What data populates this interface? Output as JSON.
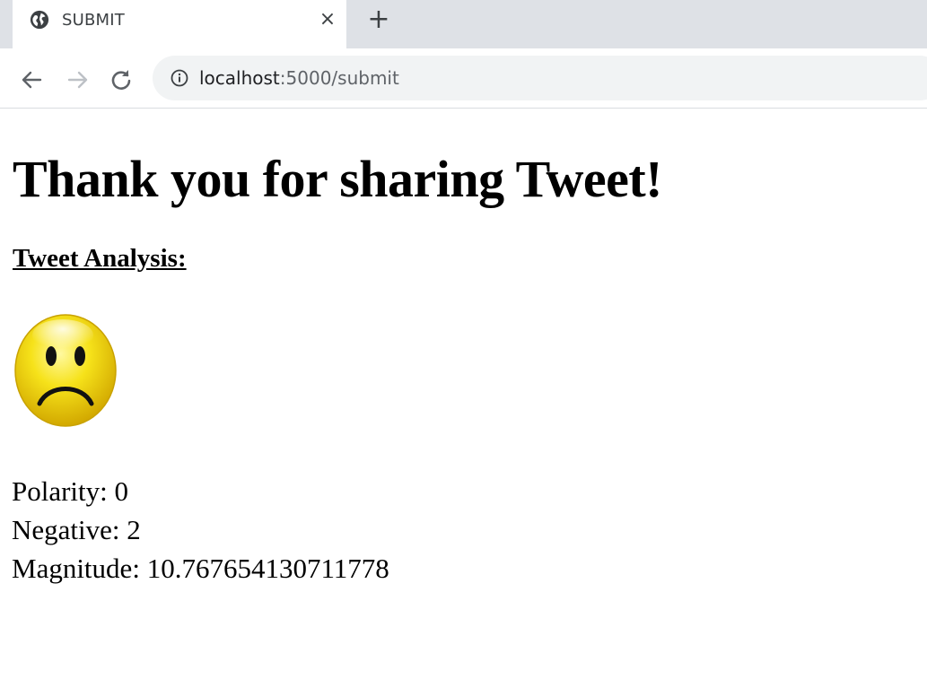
{
  "browser": {
    "tab": {
      "title": "SUBMIT",
      "favicon": "globe-icon",
      "close_icon": "close-icon"
    },
    "new_tab_icon": "plus-icon",
    "nav": {
      "back_icon": "arrow-left-icon",
      "forward_icon": "arrow-right-icon",
      "reload_icon": "reload-icon"
    },
    "address_bar": {
      "info_icon": "info-icon",
      "host": "localhost",
      "rest": ":5000/submit"
    }
  },
  "page": {
    "heading": "Thank you for sharing Tweet!",
    "subheading": "Tweet Analysis:",
    "sentiment_icon": "sad-face-icon",
    "metrics": [
      {
        "label": "Polarity",
        "value": "0"
      },
      {
        "label": "Negative",
        "value": "2"
      },
      {
        "label": "Magnitude",
        "value": "10.767654130711778"
      }
    ]
  },
  "colors": {
    "tabstrip_bg": "#dee1e6",
    "omnibox_bg": "#f1f3f4",
    "icon_gray": "#5f6368",
    "face_yellow": "#f2d20a"
  }
}
